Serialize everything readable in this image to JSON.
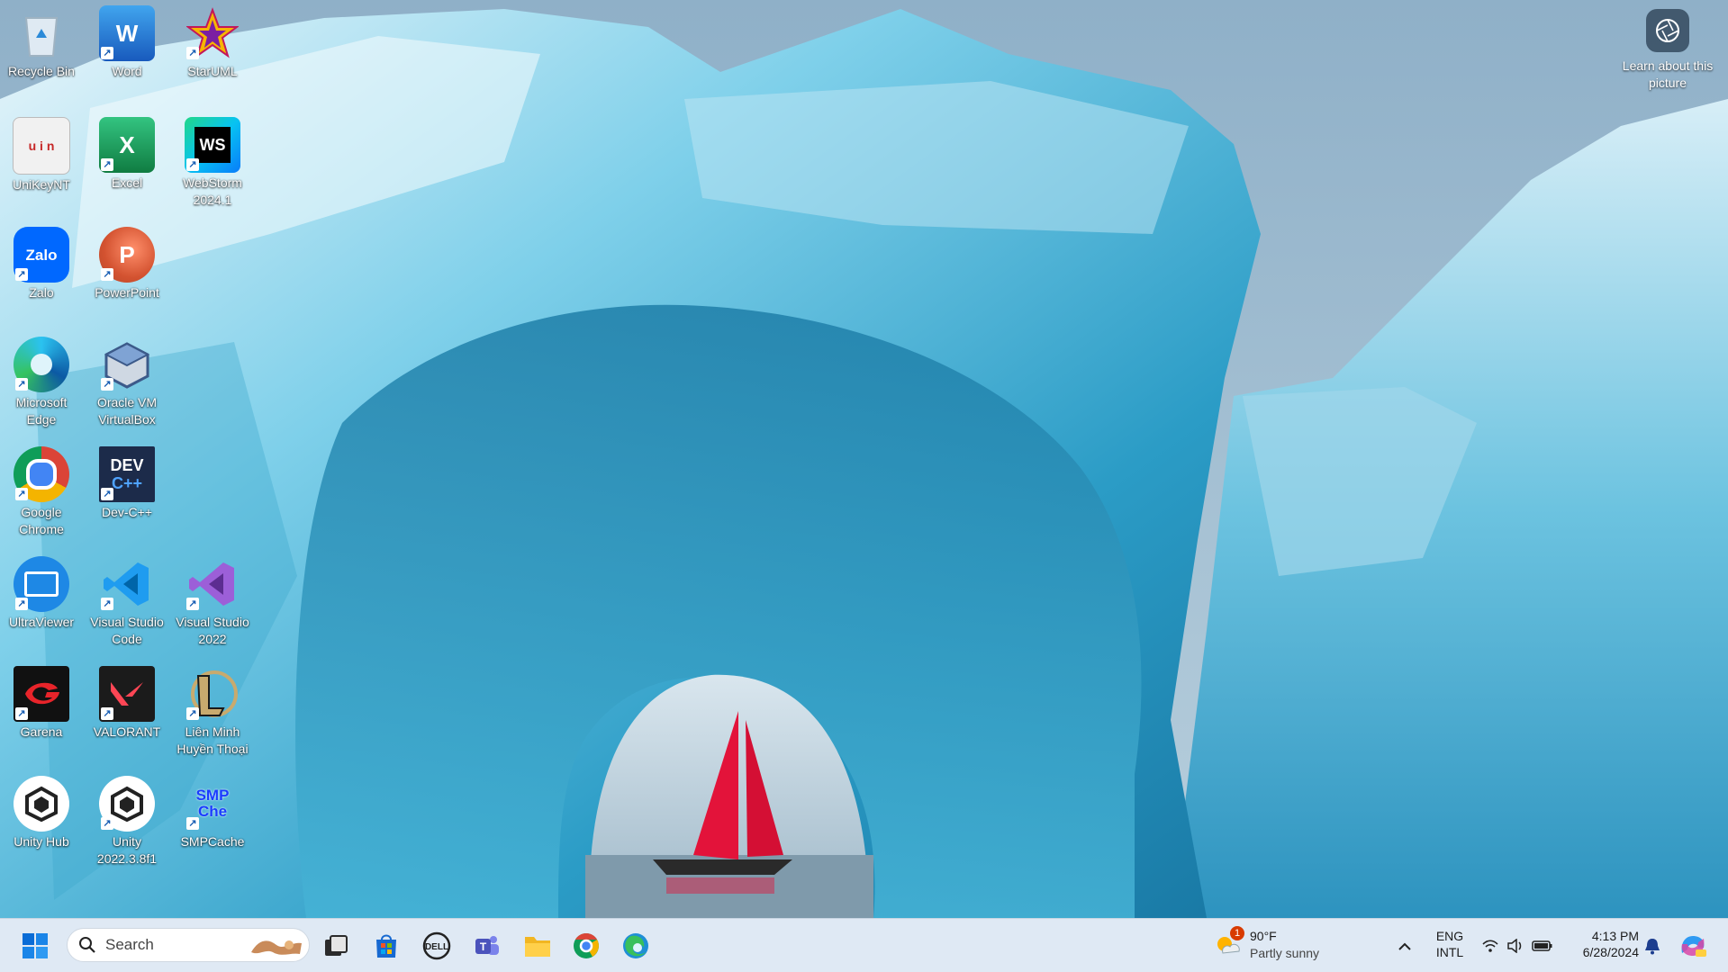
{
  "desktop": {
    "icons": [
      {
        "label": "Recycle Bin",
        "icon": "recycle-bin-icon"
      },
      {
        "label": "Word",
        "icon": "word-icon"
      },
      {
        "label": "StarUML",
        "icon": "staruml-icon"
      },
      {
        "label": "UniKeyNT",
        "icon": "unikey-icon"
      },
      {
        "label": "Excel",
        "icon": "excel-icon"
      },
      {
        "label": "WebStorm 2024.1",
        "icon": "webstorm-icon"
      },
      {
        "label": "Zalo",
        "icon": "zalo-icon"
      },
      {
        "label": "PowerPoint",
        "icon": "powerpoint-icon"
      },
      {
        "label": "Microsoft Edge",
        "icon": "edge-icon"
      },
      {
        "label": "Oracle VM VirtualBox",
        "icon": "virtualbox-icon"
      },
      {
        "label": "Google Chrome",
        "icon": "chrome-icon"
      },
      {
        "label": "Dev-C++",
        "icon": "devcpp-icon"
      },
      {
        "label": "UltraViewer",
        "icon": "ultraviewer-icon"
      },
      {
        "label": "Visual Studio Code",
        "icon": "vscode-icon"
      },
      {
        "label": "Visual Studio 2022",
        "icon": "visual-studio-icon"
      },
      {
        "label": "Garena",
        "icon": "garena-icon"
      },
      {
        "label": "VALORANT",
        "icon": "valorant-icon"
      },
      {
        "label": "Liên Minh Huyền Thoại",
        "icon": "league-icon"
      },
      {
        "label": "Unity Hub",
        "icon": "unity-hub-icon"
      },
      {
        "label": "Unity 2022.3.8f1",
        "icon": "unity-icon"
      },
      {
        "label": "SMPCache",
        "icon": "smpcache-icon"
      }
    ],
    "learn_about": "Learn about this picture",
    "icon_word": {
      "letter": "W"
    },
    "icon_excel": {
      "letter": "X"
    },
    "icon_ppt": {
      "letter": "P"
    },
    "icon_ws": {
      "letter": "WS"
    },
    "icon_zalo": {
      "letter": "Zalo"
    },
    "icon_dev": {
      "line1": "DEV",
      "line2": "C++"
    },
    "icon_smp": {
      "line1": "SMP",
      "line2": "Che"
    },
    "icon_unikey": {
      "letters": "u i n"
    }
  },
  "taskbar": {
    "search_placeholder": "Search",
    "pinned": [
      "start-icon",
      "search",
      "task-view-icon",
      "store-icon",
      "dell-icon",
      "teams-icon",
      "file-explorer-icon",
      "chrome-icon",
      "edge-icon"
    ],
    "weather": {
      "temp": "90°F",
      "desc": "Partly sunny",
      "badge": "1"
    },
    "language": {
      "line1": "ENG",
      "line2": "INTL"
    },
    "clock": {
      "time": "4:13 PM",
      "date": "6/28/2024"
    }
  },
  "colors": {
    "taskbar_bg": "#dfe9f4",
    "ice": "#4fb6d8",
    "sail": "#e3133a"
  }
}
